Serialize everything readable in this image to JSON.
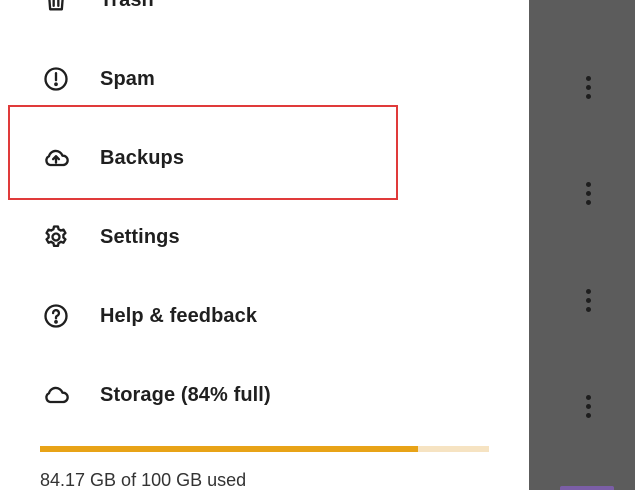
{
  "drawer": {
    "items": [
      {
        "label": "Trash",
        "icon": "trash-icon"
      },
      {
        "label": "Spam",
        "icon": "spam-icon"
      },
      {
        "label": "Backups",
        "icon": "cloud-upload-icon"
      },
      {
        "label": "Settings",
        "icon": "gear-icon"
      },
      {
        "label": "Help & feedback",
        "icon": "help-icon"
      },
      {
        "label": "Storage (84% full)",
        "icon": "cloud-icon"
      }
    ]
  },
  "storage": {
    "used_fraction": 0.8417,
    "usage_text": "84.17 GB of 100 GB used"
  },
  "colors": {
    "highlight": "#e03a3a",
    "storage_fill": "#e8a317",
    "storage_track": "#f6e3c2",
    "scrim": "#5c5c5c"
  }
}
